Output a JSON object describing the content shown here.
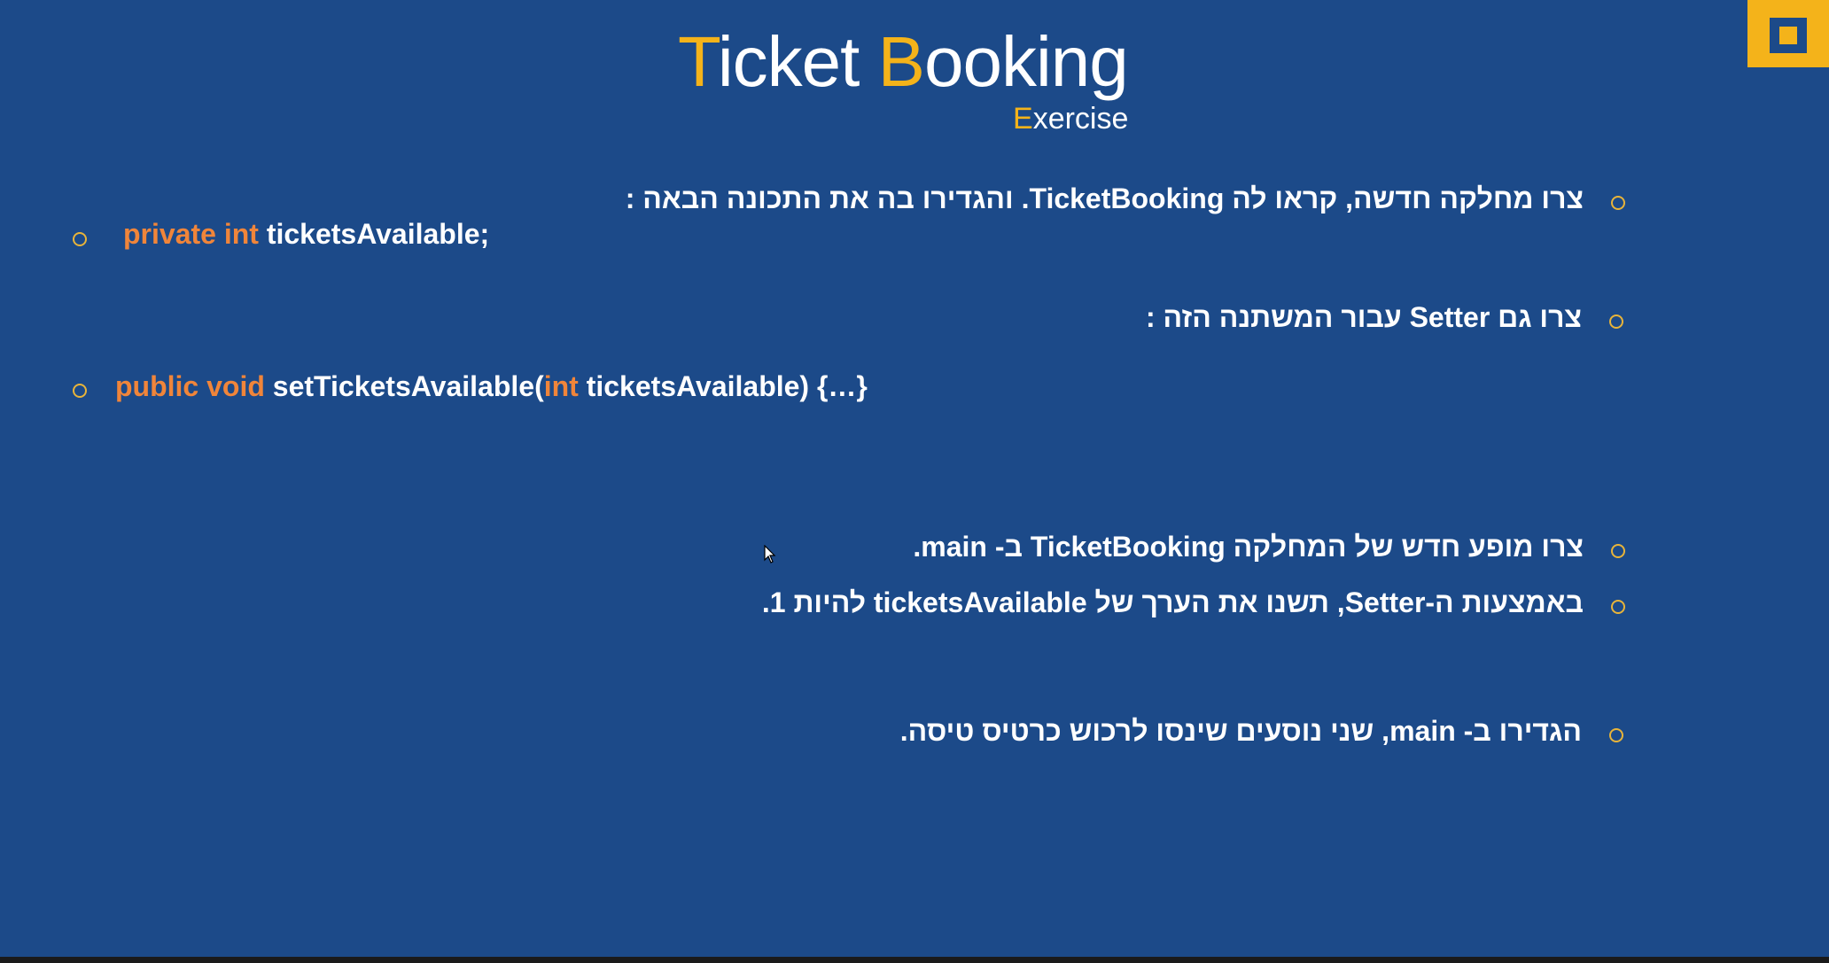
{
  "title": {
    "first_accent": "T",
    "first_rest": "icket ",
    "second_accent": "B",
    "second_rest": "ooking"
  },
  "subtitle": {
    "accent": "E",
    "rest": "xercise"
  },
  "bullets": {
    "b1": "צרו מחלקה חדשה, קראו לה TicketBooking. והגדירו בה את התכונה הבאה :",
    "b2": "צרו גם Setter עבור המשתנה הזה :",
    "b3": "צרו מופע חדש של המחלקה TicketBooking ב- main.",
    "b4": "באמצעות ה-Setter, תשנו את הערך של ticketsAvailable להיות 1.",
    "b5": "הגדירו ב- main, שני נוסעים שינסו לרכוש כרטיס טיסה."
  },
  "code1": {
    "kw1": "private",
    "kw2": "int",
    "rest": " ticketsAvailable;"
  },
  "code2": {
    "kw1": "public",
    "kw2": "void",
    "name": " setTicketsAvailable(",
    "kw3": "int",
    "rest": " ticketsAvailable) {…}"
  },
  "colors": {
    "background": "#1c4a89",
    "accent": "#f4b31a",
    "keyword": "#f0853a",
    "text": "#ffffff"
  },
  "icons": {
    "corner": "slide-corner-square-icon",
    "bullet": "hollow-circle-bullet-icon",
    "cursor": "mouse-pointer-icon"
  }
}
